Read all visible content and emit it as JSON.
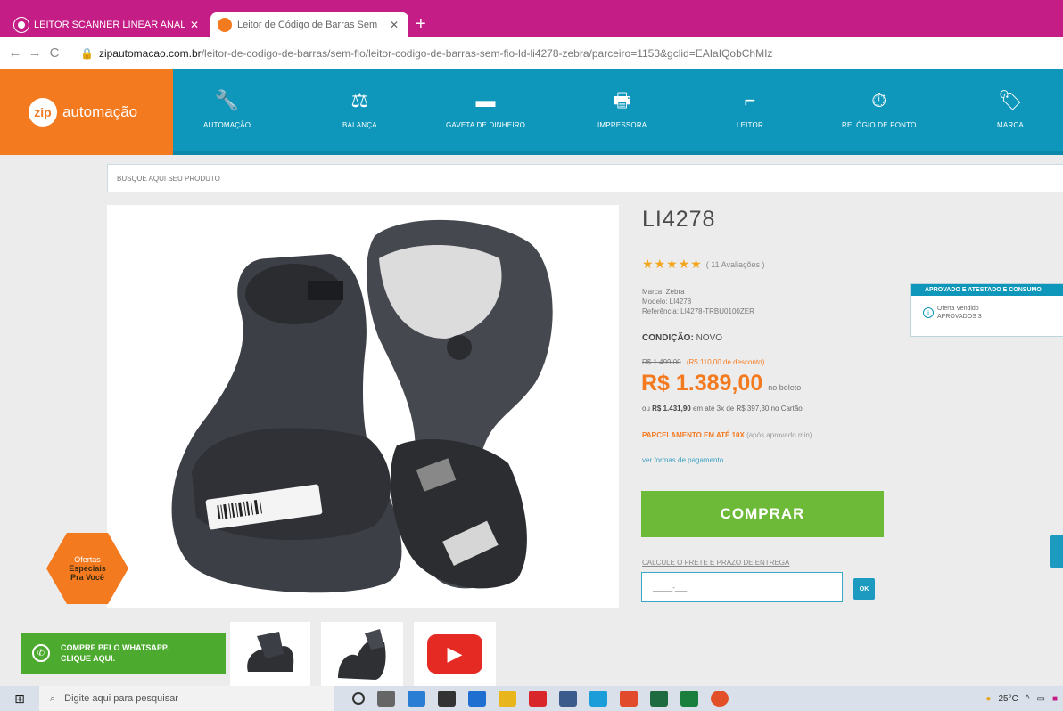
{
  "browser": {
    "tabs": [
      {
        "title": "LEITOR SCANNER LINEAR ANAL",
        "active": false
      },
      {
        "title": "Leitor de Código de Barras Sem",
        "active": true
      }
    ],
    "new_tab": "+",
    "nav": {
      "back": "←",
      "forward": "→",
      "reload": "C"
    },
    "url_domain": "zipautomacao.com.br",
    "url_rest": "/leitor-de-codigo-de-barras/sem-fio/leitor-codigo-de-barras-sem-fio-ld-li4278-zebra/parceiro=1153&gclid=EAIaIQobChMIz"
  },
  "header": {
    "logo_mark": "zip",
    "logo_text": "automação",
    "nav": [
      {
        "label": "AUTOMAÇÃO",
        "icon": "wrench-icon",
        "glyph": "🔧"
      },
      {
        "label": "BALANÇA",
        "icon": "scale-icon",
        "glyph": "⚖"
      },
      {
        "label": "GAVETA DE DINHEIRO",
        "icon": "cash-drawer-icon",
        "glyph": "▬"
      },
      {
        "label": "IMPRESSORA",
        "icon": "printer-icon",
        "glyph": "🖶"
      },
      {
        "label": "LEITOR",
        "icon": "scanner-icon",
        "glyph": "⌐"
      },
      {
        "label": "RELÓGIO DE PONTO",
        "icon": "time-clock-icon",
        "glyph": "⏱"
      },
      {
        "label": "MARCA",
        "icon": "brand-icon",
        "glyph": "🏷"
      }
    ]
  },
  "search": {
    "placeholder": "BUSQUE AQUI SEU PRODUTO"
  },
  "offer_badge": {
    "line1": "Ofertas",
    "line2": "Especiais",
    "line3": "Pra Você"
  },
  "product": {
    "title": "LI4278",
    "stars": "★★★★★",
    "reviews": "( 11 Avaliações )",
    "brand": "Marca: Zebra",
    "model": "Modelo: LI4278",
    "reference": "Referência: LI4278-TRBU0100ZER",
    "condition_label": "CONDIÇÃO:",
    "condition_value": "NOVO",
    "old_price": "R$ 1.499,00",
    "discount": "(R$ 110,00 de desconto)",
    "price": "R$ 1.389,00",
    "price_note": "no boleto",
    "alt_prefix": "ou",
    "alt_price": "R$ 1.431,90",
    "alt_detail": "em até 3x de R$ 397,30 no Cartão",
    "installments_bold": "PARCELAMENTO EM ATÉ 10X",
    "installments_rest": "(após aprovado min)",
    "payment_link": "ver formas de pagamento",
    "buy_label": "COMPRAR",
    "freight_label": "CALCULE O FRETE E PRAZO DE ENTREGA",
    "freight_placeholder": "_____-___",
    "freight_button": "OK"
  },
  "seller": {
    "header": "APROVADO E ATESTADO E CONSUMO",
    "line1": "Oferta Vendido",
    "line2": "APROVADOS 3"
  },
  "whatsapp": {
    "line1": "COMPRE PELO WHATSAPP.",
    "line2": "CLIQUE AQUI."
  },
  "taskbar": {
    "search_placeholder": "Digite aqui para pesquisar",
    "temperature": "25°C",
    "tray_up": "^"
  },
  "colors": {
    "brand_orange": "#f47a20",
    "brand_teal": "#0e97ba",
    "buy_green": "#6cba37",
    "tab_magenta": "#c51d86"
  }
}
